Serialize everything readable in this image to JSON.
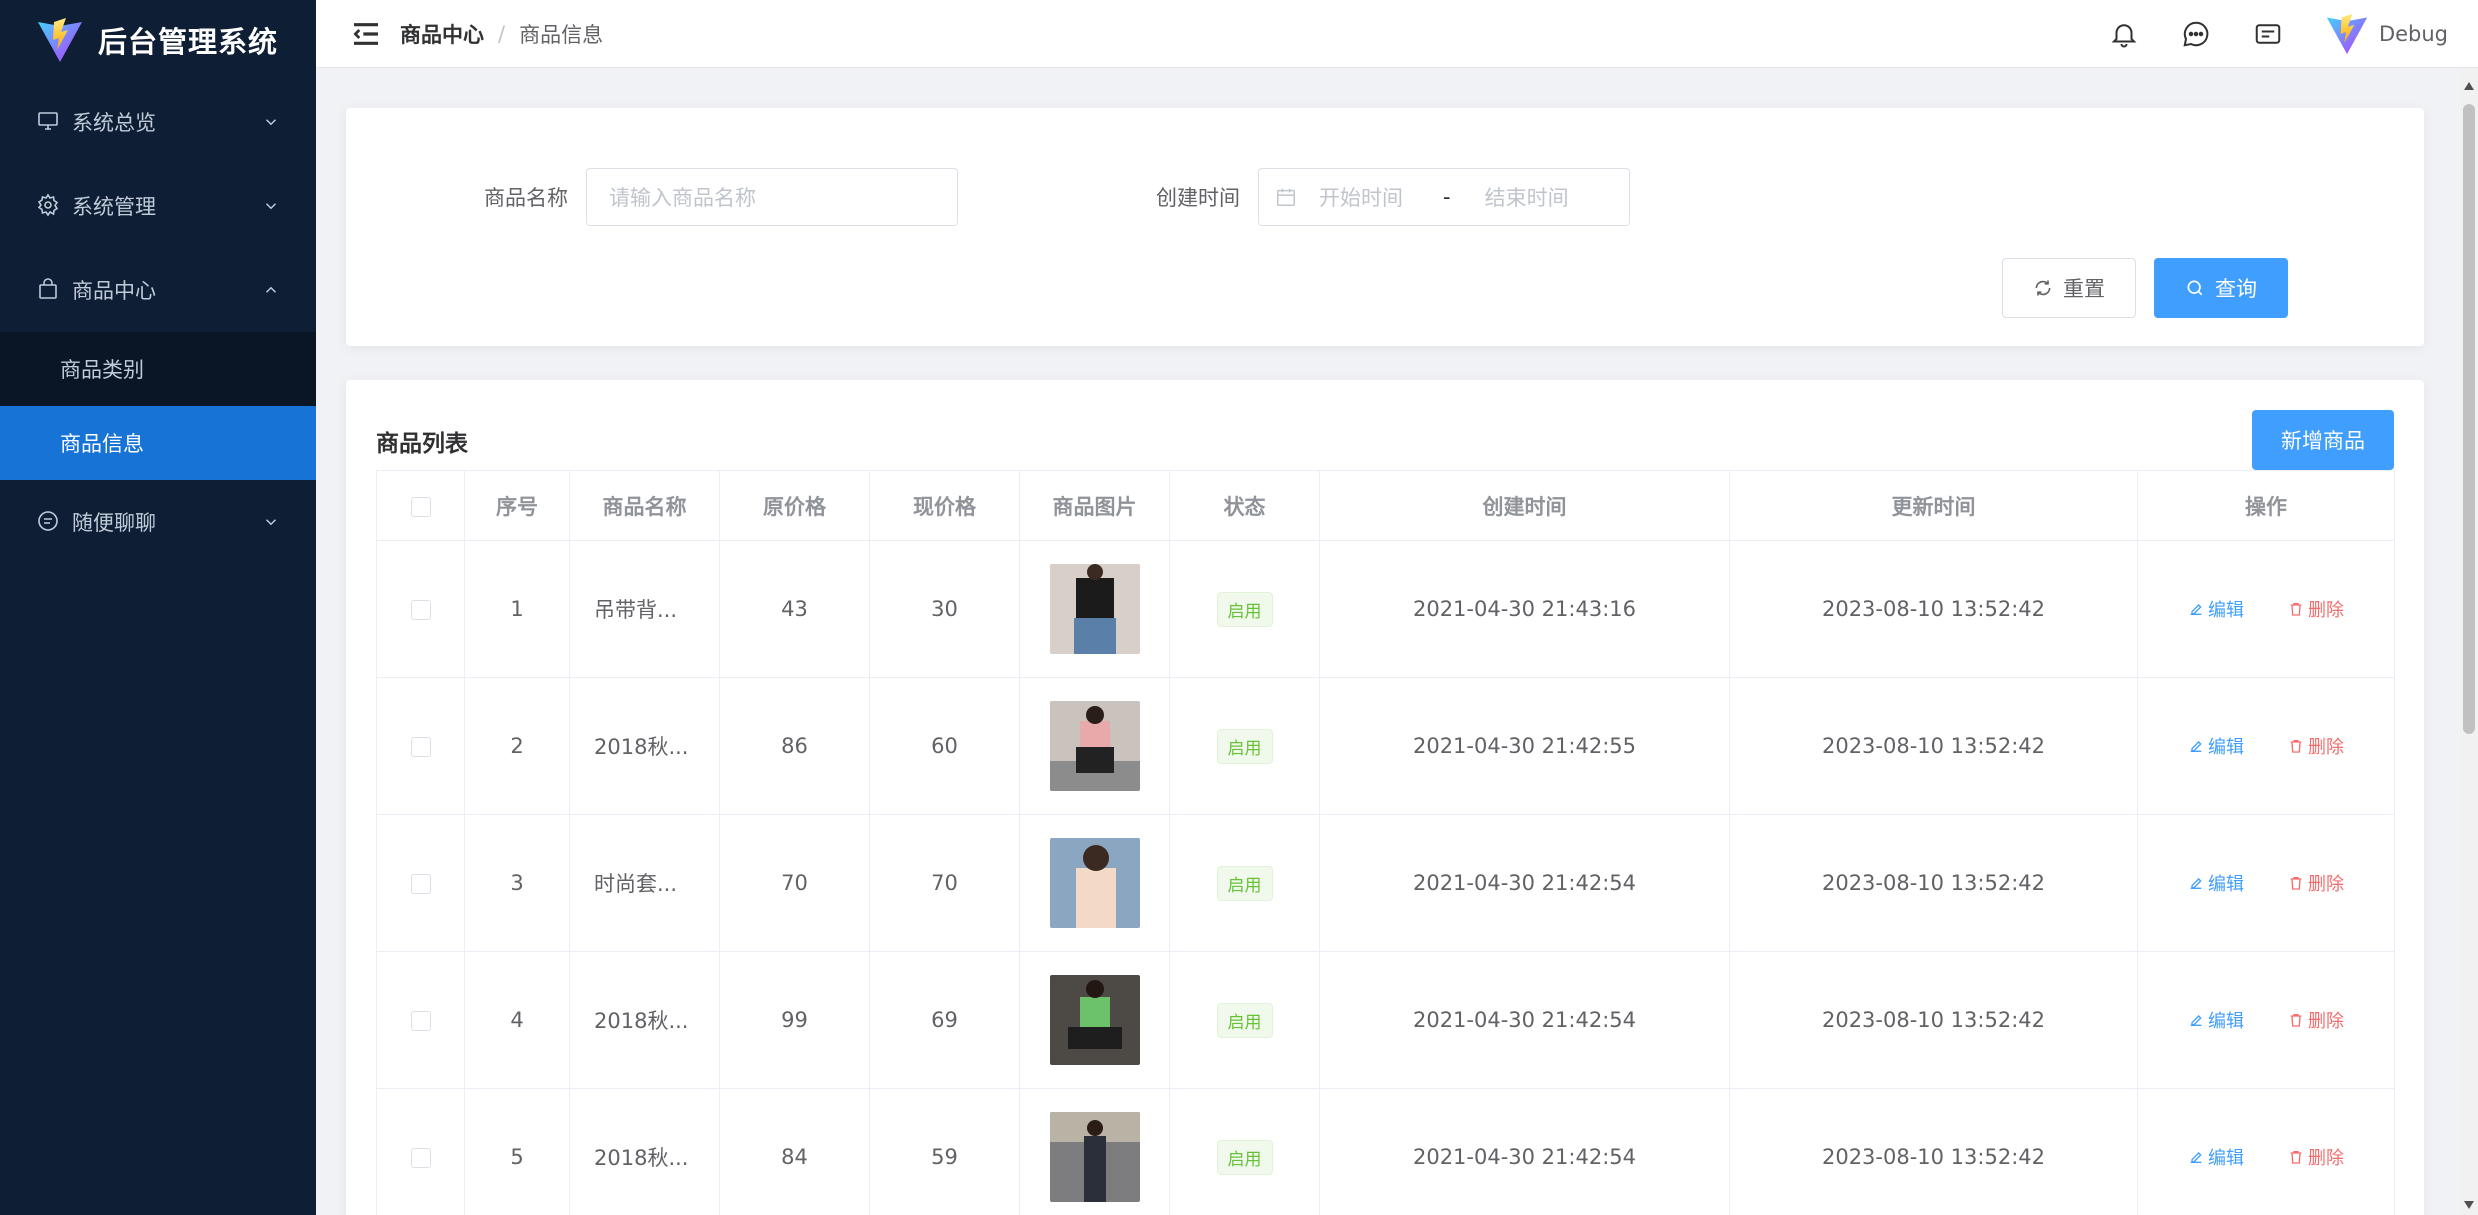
{
  "app": {
    "title": "后台管理系统"
  },
  "sidebar": {
    "items": [
      {
        "label": "系统总览",
        "icon": "monitor-icon",
        "expanded": false
      },
      {
        "label": "系统管理",
        "icon": "gear-icon",
        "expanded": false
      },
      {
        "label": "商品中心",
        "icon": "bag-icon",
        "expanded": true,
        "children": [
          {
            "label": "商品类别",
            "active": false
          },
          {
            "label": "商品信息",
            "active": true
          }
        ]
      },
      {
        "label": "随便聊聊",
        "icon": "chat-icon",
        "expanded": false
      }
    ]
  },
  "header": {
    "breadcrumb": [
      "商品中心",
      "商品信息"
    ],
    "breadcrumb_sep": "/",
    "user": "Debug"
  },
  "search": {
    "name_label": "商品名称",
    "name_placeholder": "请输入商品名称",
    "time_label": "创建时间",
    "start_placeholder": "开始时间",
    "end_placeholder": "结束时间",
    "range_sep": "-",
    "reset_label": "重置",
    "query_label": "查询"
  },
  "table": {
    "title": "商品列表",
    "add_label": "新增商品",
    "columns": [
      "序号",
      "商品名称",
      "原价格",
      "现价格",
      "商品图片",
      "状态",
      "创建时间",
      "更新时间",
      "操作"
    ],
    "edit_label": "编辑",
    "delete_label": "删除",
    "rows": [
      {
        "index": "1",
        "name": "吊带背...",
        "orig": "43",
        "now": "30",
        "status": "启用",
        "created": "2021-04-30 21:43:16",
        "updated": "2023-08-10 13:52:42"
      },
      {
        "index": "2",
        "name": "2018秋...",
        "orig": "86",
        "now": "60",
        "status": "启用",
        "created": "2021-04-30 21:42:55",
        "updated": "2023-08-10 13:52:42"
      },
      {
        "index": "3",
        "name": "时尚套...",
        "orig": "70",
        "now": "70",
        "status": "启用",
        "created": "2021-04-30 21:42:54",
        "updated": "2023-08-10 13:52:42"
      },
      {
        "index": "4",
        "name": "2018秋...",
        "orig": "99",
        "now": "69",
        "status": "启用",
        "created": "2021-04-30 21:42:54",
        "updated": "2023-08-10 13:52:42"
      },
      {
        "index": "5",
        "name": "2018秋...",
        "orig": "84",
        "now": "59",
        "status": "启用",
        "created": "2021-04-30 21:42:54",
        "updated": "2023-08-10 13:52:42"
      }
    ]
  },
  "colors": {
    "sidebar_bg": "#0e1e34",
    "active_menu": "#1773d6",
    "primary": "#409eff",
    "danger": "#f56c6c",
    "success": "#67c23a"
  }
}
